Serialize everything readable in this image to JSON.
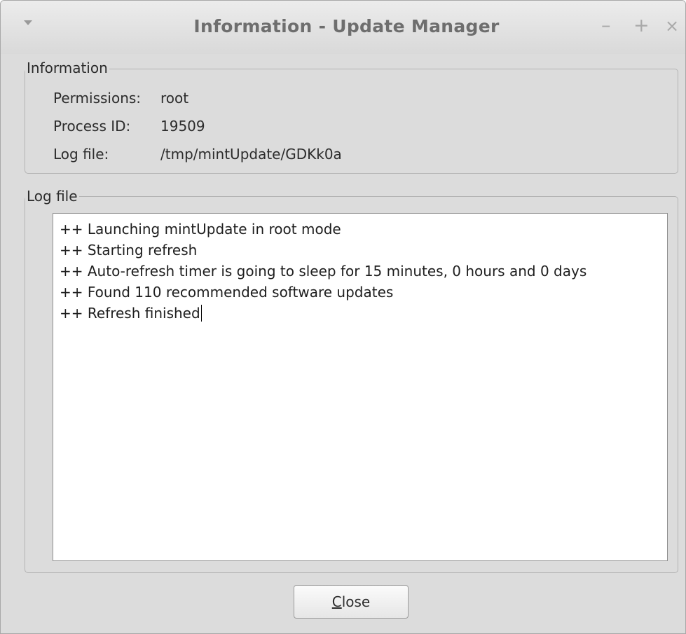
{
  "window": {
    "title": "Information - Update Manager",
    "controls": {
      "menu_icon": "down-triangle-icon",
      "minimize": "–",
      "maximize": "+",
      "close": "×"
    }
  },
  "information": {
    "legend": "Information",
    "rows": [
      {
        "label": "Permissions:",
        "value": "root"
      },
      {
        "label": "Process ID:",
        "value": "19509"
      },
      {
        "label": "Log file:",
        "value": "/tmp/mintUpdate/GDKk0a"
      }
    ]
  },
  "log": {
    "legend": "Log file",
    "lines": [
      "++ Launching mintUpdate in root mode",
      "++ Starting refresh",
      "++ Auto-refresh timer is going to sleep for 15 minutes, 0 hours and 0 days",
      "++ Found 110 recommended software updates",
      "++ Refresh finished"
    ]
  },
  "buttons": {
    "close_mnemonic": "C",
    "close_rest": "lose"
  }
}
